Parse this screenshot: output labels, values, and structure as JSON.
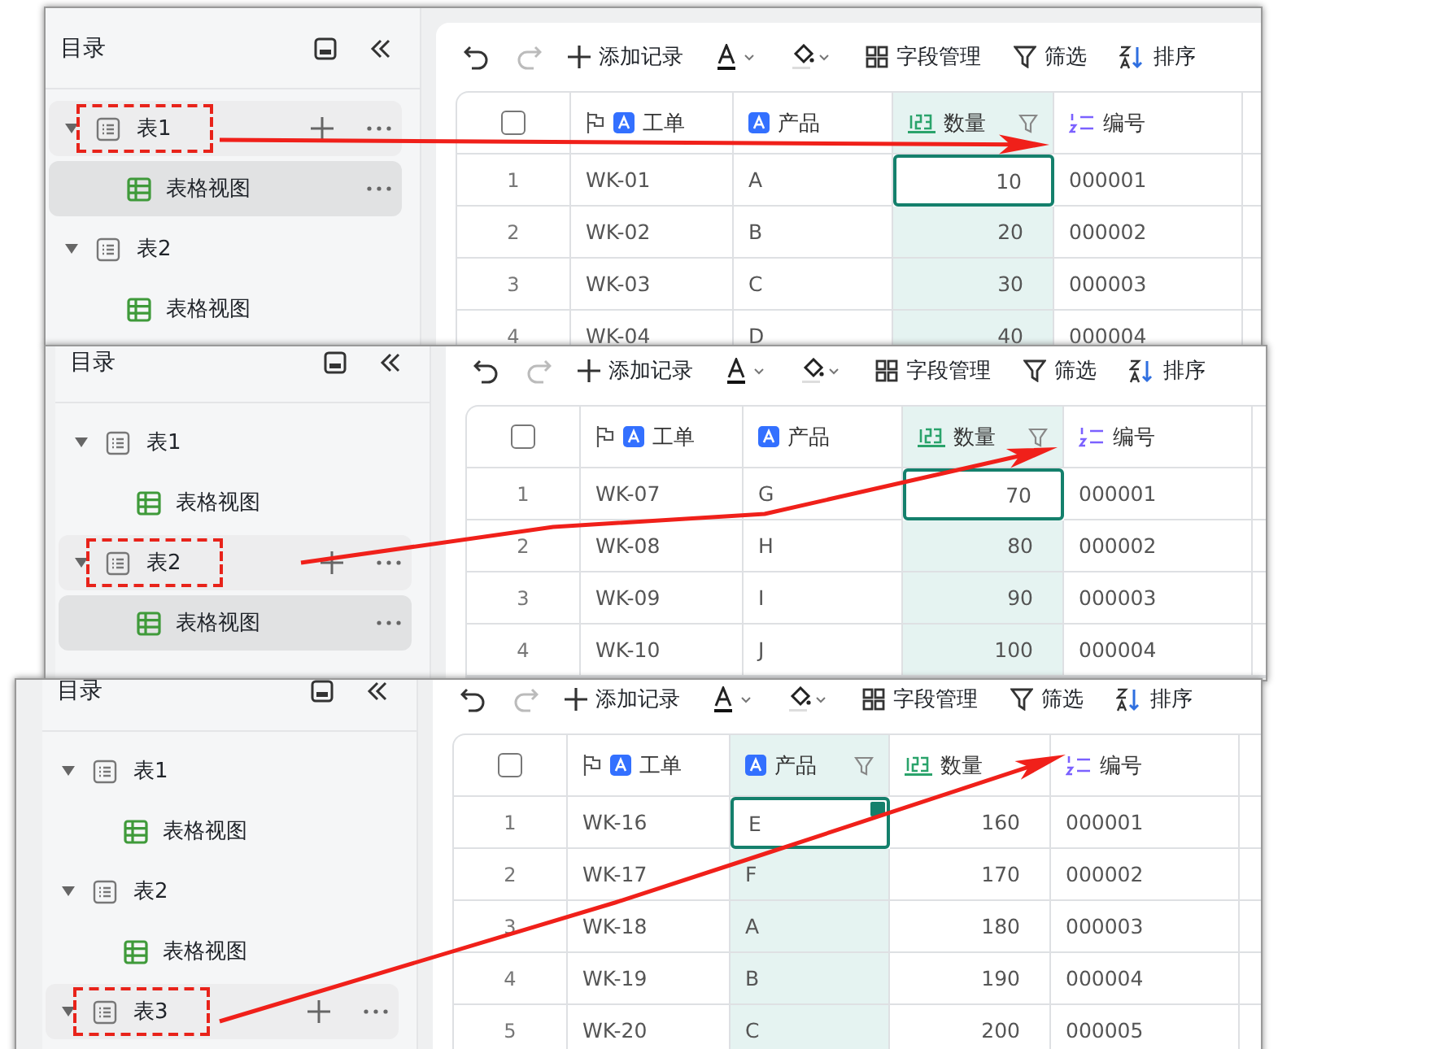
{
  "panels": [
    {
      "arrow": true,
      "sidebar": {
        "title": "目录",
        "tables": [
          {
            "name": "表1",
            "expanded": true,
            "hovered": true,
            "highlighted": true,
            "views": [
              {
                "name": "表格视图",
                "selected": true
              }
            ]
          },
          {
            "name": "表2",
            "expanded": true,
            "hovered": false,
            "highlighted": false,
            "views": [
              {
                "name": "表格视图",
                "selected": false
              }
            ]
          }
        ]
      },
      "toolbar": {
        "add_record": "添加记录",
        "fields": "字段管理",
        "filter": "筛选",
        "sort": "排序"
      },
      "grid": {
        "select_all": {
          "checked": false
        },
        "columns": [
          {
            "name": "工单",
            "kind": "text",
            "primary": true,
            "selected": false
          },
          {
            "name": "产品",
            "kind": "text",
            "primary": false,
            "selected": false
          },
          {
            "name": "数量",
            "kind": "number",
            "primary": false,
            "selected": true
          },
          {
            "name": "编号",
            "kind": "autonumber",
            "primary": false,
            "selected": false
          }
        ],
        "rows": [
          {
            "number": "1",
            "active": true,
            "cells": [
              "WK-01",
              "A",
              "10",
              "000001"
            ]
          },
          {
            "number": "2",
            "active": false,
            "cells": [
              "WK-02",
              "B",
              "20",
              "000002"
            ]
          },
          {
            "number": "3",
            "active": false,
            "cells": [
              "WK-03",
              "C",
              "30",
              "000003"
            ]
          },
          {
            "number": "4",
            "active": false,
            "cells": [
              "WK-04",
              "D",
              "40",
              "000004"
            ]
          }
        ]
      }
    },
    {
      "arrow": true,
      "sidebar": {
        "title": "目录",
        "tables": [
          {
            "name": "表1",
            "expanded": true,
            "hovered": false,
            "highlighted": false,
            "views": [
              {
                "name": "表格视图",
                "selected": false
              }
            ]
          },
          {
            "name": "表2",
            "expanded": true,
            "hovered": true,
            "highlighted": true,
            "views": [
              {
                "name": "表格视图",
                "selected": true
              }
            ]
          }
        ]
      },
      "toolbar": {
        "add_record": "添加记录",
        "fields": "字段管理",
        "filter": "筛选",
        "sort": "排序"
      },
      "grid": {
        "select_all": {
          "checked": false
        },
        "columns": [
          {
            "name": "工单",
            "kind": "text",
            "primary": true,
            "selected": false
          },
          {
            "name": "产品",
            "kind": "text",
            "primary": false,
            "selected": false
          },
          {
            "name": "数量",
            "kind": "number",
            "primary": false,
            "selected": true
          },
          {
            "name": "编号",
            "kind": "autonumber",
            "primary": false,
            "selected": false
          }
        ],
        "rows": [
          {
            "number": "1",
            "active": true,
            "cells": [
              "WK-07",
              "G",
              "70",
              "000001"
            ]
          },
          {
            "number": "2",
            "active": false,
            "cells": [
              "WK-08",
              "H",
              "80",
              "000002"
            ]
          },
          {
            "number": "3",
            "active": false,
            "cells": [
              "WK-09",
              "I",
              "90",
              "000003"
            ]
          },
          {
            "number": "4",
            "active": false,
            "cells": [
              "WK-10",
              "J",
              "100",
              "000004"
            ]
          }
        ]
      }
    },
    {
      "arrow": true,
      "sidebar": {
        "title": "目录",
        "tables": [
          {
            "name": "表1",
            "expanded": true,
            "hovered": false,
            "highlighted": false,
            "views": [
              {
                "name": "表格视图",
                "selected": false
              }
            ]
          },
          {
            "name": "表2",
            "expanded": true,
            "hovered": false,
            "highlighted": false,
            "views": [
              {
                "name": "表格视图",
                "selected": false
              }
            ]
          },
          {
            "name": "表3",
            "expanded": true,
            "hovered": true,
            "highlighted": true
          }
        ]
      },
      "toolbar": {
        "add_record": "添加记录",
        "fields": "字段管理",
        "filter": "筛选",
        "sort": "排序"
      },
      "grid": {
        "select_all": {
          "checked": false
        },
        "columns": [
          {
            "name": "工单",
            "kind": "text",
            "primary": true,
            "selected": false
          },
          {
            "name": "产品",
            "kind": "text",
            "primary": false,
            "selected": true
          },
          {
            "name": "数量",
            "kind": "number",
            "primary": false,
            "selected": false
          },
          {
            "name": "编号",
            "kind": "autonumber",
            "primary": false,
            "selected": false
          }
        ],
        "rows": [
          {
            "number": "1",
            "active": true,
            "cells": [
              "WK-16",
              "E",
              "160",
              "000001"
            ]
          },
          {
            "number": "2",
            "active": false,
            "cells": [
              "WK-17",
              "F",
              "170",
              "000002"
            ]
          },
          {
            "number": "3",
            "active": false,
            "cells": [
              "WK-18",
              "A",
              "180",
              "000003"
            ]
          },
          {
            "number": "4",
            "active": false,
            "cells": [
              "WK-19",
              "B",
              "190",
              "000004"
            ]
          },
          {
            "number": "5",
            "active": false,
            "cells": [
              "WK-20",
              "C",
              "200",
              "000005"
            ]
          }
        ]
      }
    }
  ]
}
